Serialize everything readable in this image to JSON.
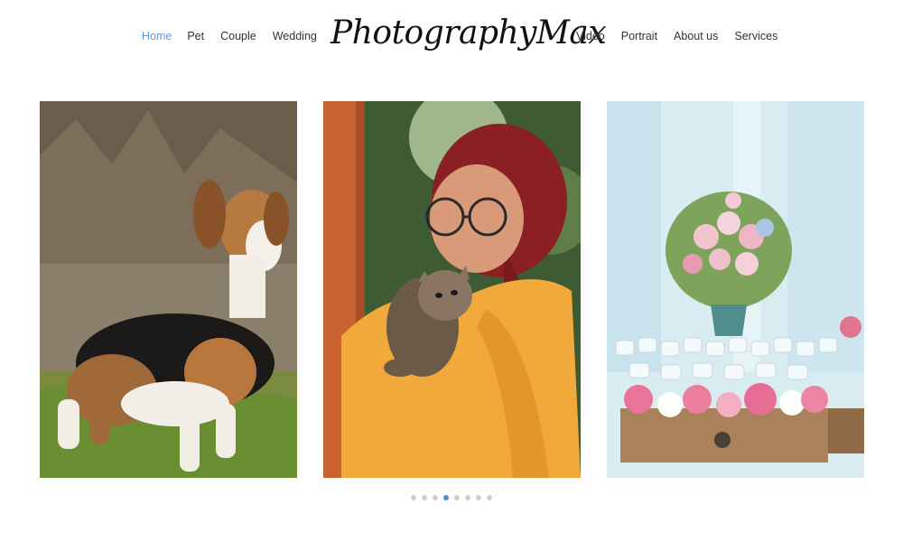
{
  "brand": {
    "logo_text": "PhotographyMax"
  },
  "nav": {
    "left": [
      {
        "label": "Home",
        "active": true
      },
      {
        "label": "Pet",
        "active": false
      },
      {
        "label": "Couple",
        "active": false
      },
      {
        "label": "Wedding",
        "active": false
      }
    ],
    "right": [
      {
        "label": "Video",
        "active": false
      },
      {
        "label": "Portrait",
        "active": false
      },
      {
        "label": "About us",
        "active": false
      },
      {
        "label": "Services",
        "active": false
      }
    ]
  },
  "slider": {
    "slides": [
      {
        "subject": "beagle-dog-photo"
      },
      {
        "subject": "woman-holding-kitten-photo"
      },
      {
        "subject": "wedding-flowers-table-photo"
      }
    ],
    "dot_count": 8,
    "active_dot": 4
  },
  "colors": {
    "accent": "#5b9bd5",
    "active_dot": "#4a90d9",
    "inactive_dot": "#cfcfcf"
  }
}
